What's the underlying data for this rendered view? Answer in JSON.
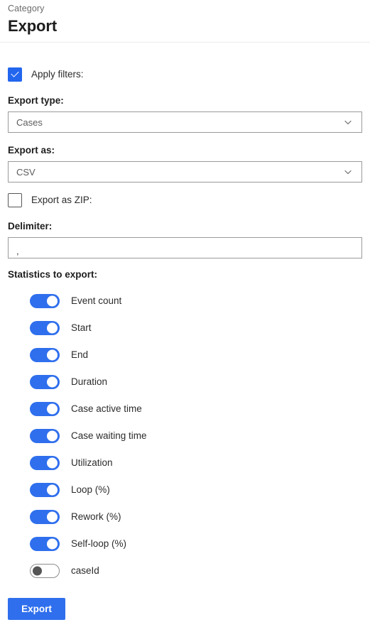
{
  "header": {
    "category_label": "Category",
    "title": "Export",
    "divider": true
  },
  "form": {
    "apply_filters": {
      "label": "Apply filters:",
      "checked": true,
      "icon": "checkmark-icon"
    },
    "export_type": {
      "label": "Export type:",
      "value": "Cases",
      "icon": "chevron-down-icon"
    },
    "export_as": {
      "label": "Export as:",
      "value": "CSV",
      "icon": "chevron-down-icon"
    },
    "export_as_zip": {
      "label": "Export as ZIP:",
      "checked": false
    },
    "delimiter": {
      "label": "Delimiter:",
      "value": ",",
      "placeholder": ""
    },
    "statistics": {
      "label": "Statistics to export:",
      "items": [
        {
          "label": "Event count",
          "on": true
        },
        {
          "label": "Start",
          "on": true
        },
        {
          "label": "End",
          "on": true
        },
        {
          "label": "Duration",
          "on": true
        },
        {
          "label": "Case active time",
          "on": true
        },
        {
          "label": "Case waiting time",
          "on": true
        },
        {
          "label": "Utilization",
          "on": true
        },
        {
          "label": "Loop (%)",
          "on": true
        },
        {
          "label": "Rework (%)",
          "on": true
        },
        {
          "label": "Self-loop (%)",
          "on": true
        },
        {
          "label": "caseId",
          "on": false
        }
      ]
    },
    "submit": {
      "label": "Export"
    }
  },
  "colors": {
    "accent": "#2f6fed",
    "checkbox_accent": "#2266ee",
    "text": "#2b2b2b",
    "muted_text": "#6b6b6b",
    "border": "#9a9a9a",
    "divider": "#ebebeb"
  }
}
